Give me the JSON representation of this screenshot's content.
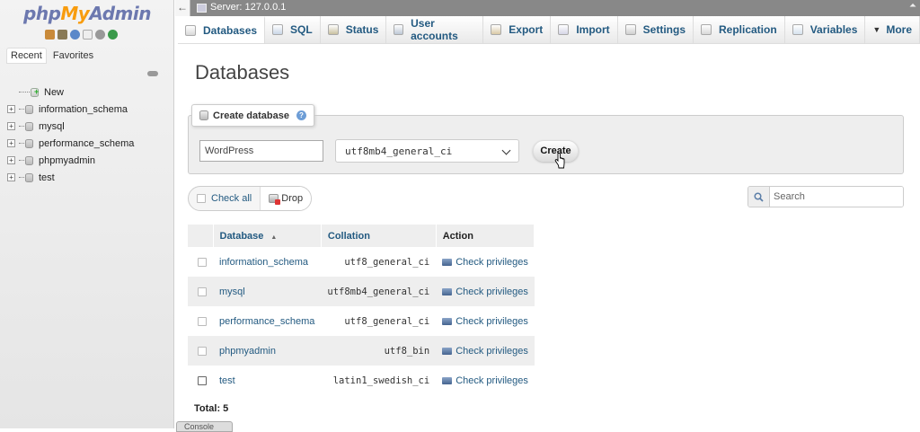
{
  "nav": {
    "logo": {
      "php": "php",
      "my": "My",
      "admin": "Admin"
    },
    "icons": [
      "home-icon",
      "database-icon",
      "help-icon",
      "docs-icon",
      "settings-icon",
      "reload-icon"
    ],
    "tabs": {
      "recent": "Recent",
      "favorites": "Favorites"
    },
    "tree": [
      {
        "label": "New",
        "kind": "new"
      },
      {
        "label": "information_schema",
        "kind": "db"
      },
      {
        "label": "mysql",
        "kind": "db"
      },
      {
        "label": "performance_schema",
        "kind": "db"
      },
      {
        "label": "phpmyadmin",
        "kind": "db"
      },
      {
        "label": "test",
        "kind": "db"
      }
    ]
  },
  "topbar": {
    "server": "Server: 127.0.0.1",
    "back_glyph": "←",
    "corner_glyph": "⏶"
  },
  "menu": {
    "tabs": [
      {
        "label": "Databases",
        "icon": "database-icon",
        "active": true
      },
      {
        "label": "SQL",
        "icon": "sql-icon"
      },
      {
        "label": "Status",
        "icon": "status-icon"
      },
      {
        "label": "User accounts",
        "icon": "users-icon"
      },
      {
        "label": "Export",
        "icon": "export-icon"
      },
      {
        "label": "Import",
        "icon": "import-icon"
      },
      {
        "label": "Settings",
        "icon": "wrench-icon"
      },
      {
        "label": "Replication",
        "icon": "replication-icon"
      },
      {
        "label": "Variables",
        "icon": "variables-icon"
      },
      {
        "label": "More",
        "icon": "caret-down-icon"
      }
    ]
  },
  "main": {
    "title": "Databases",
    "create": {
      "legend": "Create database",
      "name_value": "WordPress",
      "collation_value": "utf8mb4_general_ci",
      "create_label": "Create"
    },
    "bulk": {
      "check_all": "Check all",
      "drop": "Drop"
    },
    "search": {
      "placeholder": "Search"
    },
    "table": {
      "headers": {
        "database": "Database",
        "collation": "Collation",
        "action": "Action"
      },
      "rows": [
        {
          "name": "information_schema",
          "collation": "utf8_general_ci",
          "action": "Check privileges"
        },
        {
          "name": "mysql",
          "collation": "utf8mb4_general_ci",
          "action": "Check privileges"
        },
        {
          "name": "performance_schema",
          "collation": "utf8_general_ci",
          "action": "Check privileges"
        },
        {
          "name": "phpmyadmin",
          "collation": "utf8_bin",
          "action": "Check privileges"
        },
        {
          "name": "test",
          "collation": "latin1_swedish_ci",
          "action": "Check privileges"
        }
      ],
      "total": "Total: 5"
    },
    "console": "Console"
  },
  "colors": {
    "link": "#235a81",
    "logo_blue": "#6c78af",
    "logo_orange": "#f89c0e"
  }
}
